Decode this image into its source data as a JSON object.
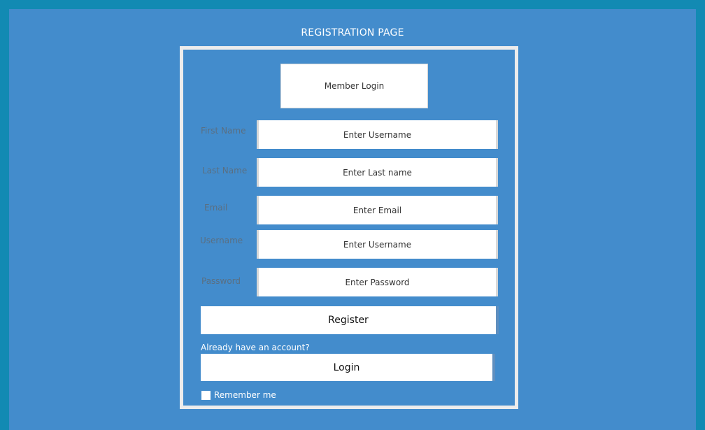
{
  "page": {
    "title": "REGISTRATION PAGE"
  },
  "member_login": {
    "label": "Member Login"
  },
  "fields": {
    "first_name": {
      "label": "First Name",
      "placeholder": "Enter Username"
    },
    "last_name": {
      "label": "Last Name",
      "placeholder": "Enter Last name"
    },
    "email": {
      "label": "Email",
      "placeholder": "Enter Email"
    },
    "username": {
      "label": "Username",
      "placeholder": "Enter Username"
    },
    "password": {
      "label": "Password",
      "placeholder": "Enter Password"
    }
  },
  "buttons": {
    "register": "Register",
    "login": "Login"
  },
  "already_account": "Already have an account?",
  "remember_me": {
    "label": "Remember me",
    "checked": false
  },
  "colors": {
    "outer_background": "#128ab3",
    "page_background": "#438ccc",
    "frame_border": "#ececec",
    "label_text": "#5a6f82"
  }
}
